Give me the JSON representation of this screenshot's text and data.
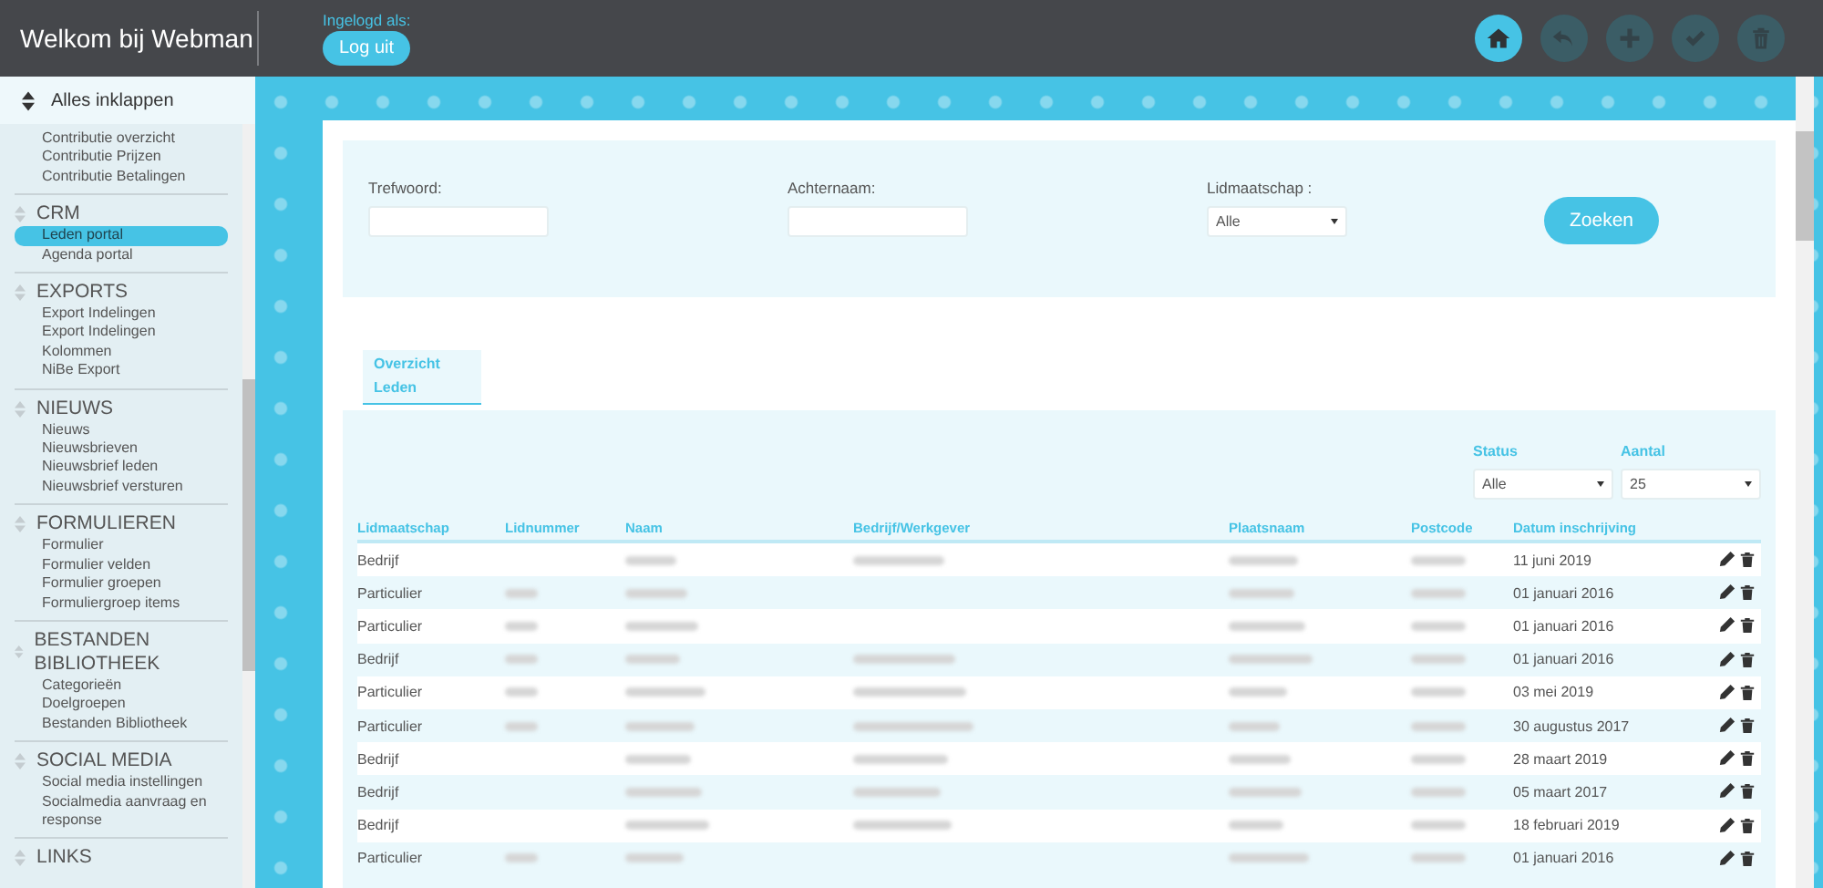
{
  "header": {
    "title": "Welkom bij Webman",
    "logged_in_label": "Ingelogd als:",
    "logout": "Log uit"
  },
  "toolbar": [
    {
      "kind": "home",
      "active": true
    },
    {
      "kind": "undo",
      "active": false
    },
    {
      "kind": "add",
      "active": false
    },
    {
      "kind": "check",
      "active": false
    },
    {
      "kind": "delete",
      "active": false
    }
  ],
  "sidebar": {
    "collapse_all": "Alles inklappen",
    "groups": [
      {
        "items": [
          {
            "label": "Contributie overzicht",
            "selected": false
          },
          {
            "label": "Contributie Prijzen",
            "selected": false
          },
          {
            "label": "Contributie Betalingen",
            "selected": false
          }
        ]
      },
      {
        "title": "CRM",
        "items": [
          {
            "label": "Leden portal",
            "selected": true
          },
          {
            "label": "Agenda portal",
            "selected": false
          }
        ]
      },
      {
        "title": "EXPORTS",
        "items": [
          {
            "label": "Export Indelingen",
            "selected": false
          },
          {
            "label": "Export Indelingen",
            "selected": false
          },
          {
            "label": "Kolommen",
            "selected": false
          },
          {
            "label": "NiBe Export",
            "selected": false
          }
        ]
      },
      {
        "title": "NIEUWS",
        "items": [
          {
            "label": "Nieuws",
            "selected": false
          },
          {
            "label": "Nieuwsbrieven",
            "selected": false
          },
          {
            "label": "Nieuwsbrief leden",
            "selected": false
          },
          {
            "label": "Nieuwsbrief versturen",
            "selected": false
          }
        ]
      },
      {
        "title": "FORMULIEREN",
        "items": [
          {
            "label": "Formulier",
            "selected": false
          },
          {
            "label": "Formulier velden",
            "selected": false
          },
          {
            "label": "Formulier groepen",
            "selected": false
          },
          {
            "label": "Formuliergroep items",
            "selected": false
          }
        ]
      },
      {
        "title": "BESTANDEN BIBLIOTHEEK",
        "items": [
          {
            "label": "Categorieën",
            "selected": false
          },
          {
            "label": "Doelgroepen",
            "selected": false
          },
          {
            "label": "Bestanden Bibliotheek",
            "selected": false
          }
        ]
      },
      {
        "title": "SOCIAL MEDIA",
        "items": [
          {
            "label": "Social media instellingen",
            "selected": false
          },
          {
            "label": "Socialmedia aanvraag en response",
            "selected": false
          }
        ]
      },
      {
        "title": "LINKS"
      }
    ]
  },
  "filters": {
    "keyword_label": "Trefwoord:",
    "lastname_label": "Achternaam:",
    "membership_label": "Lidmaatschap :",
    "membership_value": "Alle",
    "search_button": "Zoeken"
  },
  "tabs": [
    {
      "label": "Overzicht Leden",
      "selected": true
    }
  ],
  "table_controls": {
    "status_label": "Status",
    "status_value": "Alle",
    "count_label": "Aantal",
    "count_value": "25"
  },
  "table": {
    "columns": [
      "Lidmaatschap",
      "Lidnummer",
      "Naam",
      "Bedrijf/Werkgever",
      "Plaatsnaam",
      "Postcode",
      "Datum inschrijving"
    ],
    "rows": [
      {
        "membership": "Bedrijf",
        "has_number": false,
        "has_company": true,
        "date": "11 juni 2019"
      },
      {
        "membership": "Particulier",
        "has_number": true,
        "has_company": false,
        "date": "01 januari 2016"
      },
      {
        "membership": "Particulier",
        "has_number": true,
        "has_company": false,
        "date": "01 januari 2016"
      },
      {
        "membership": "Bedrijf",
        "has_number": true,
        "has_company": true,
        "date": "01 januari 2016"
      },
      {
        "membership": "Particulier",
        "has_number": true,
        "has_company": true,
        "date": "03 mei 2019"
      },
      {
        "membership": "Particulier",
        "has_number": true,
        "has_company": true,
        "date": "30 augustus 2017"
      },
      {
        "membership": "Bedrijf",
        "has_number": false,
        "has_company": true,
        "date": "28 maart 2019"
      },
      {
        "membership": "Bedrijf",
        "has_number": false,
        "has_company": true,
        "date": "05 maart 2017"
      },
      {
        "membership": "Bedrijf",
        "has_number": false,
        "has_company": true,
        "date": "18 februari 2019"
      },
      {
        "membership": "Particulier",
        "has_number": true,
        "has_company": false,
        "date": "01 januari 2016"
      }
    ]
  }
}
